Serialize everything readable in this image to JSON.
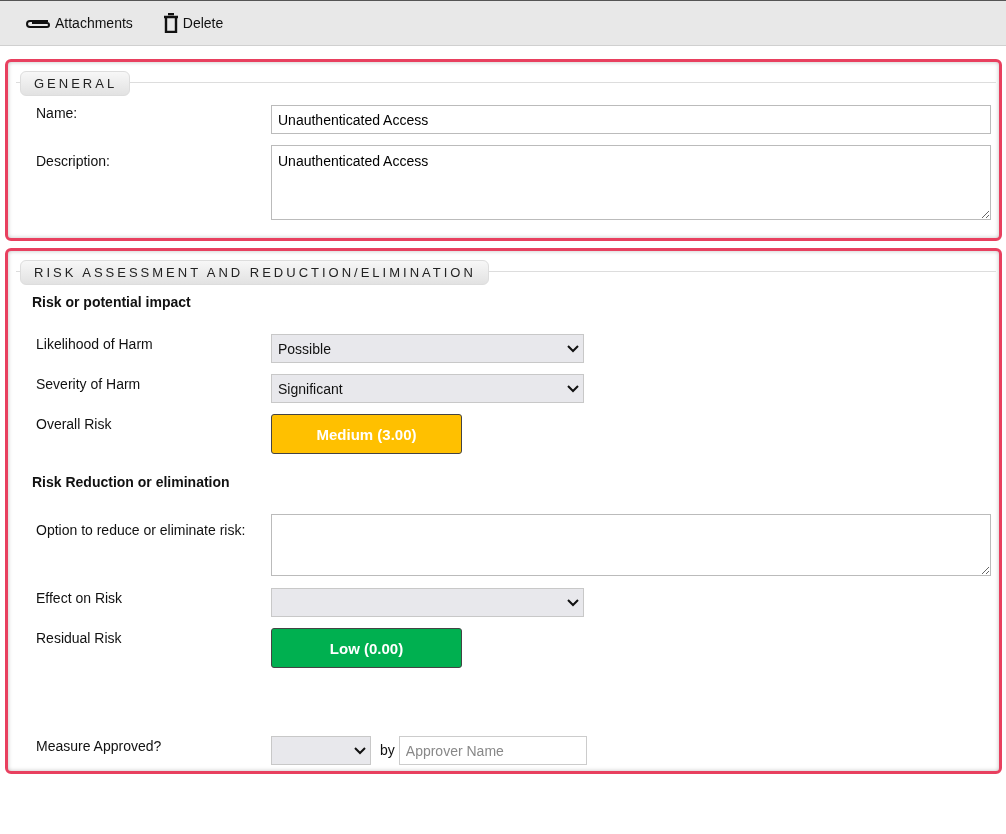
{
  "toolbar": [
    {
      "kind": "attach",
      "label": "Attachments"
    },
    {
      "kind": "delete",
      "label": "Delete"
    }
  ],
  "sections": [
    {
      "title": "GENERAL",
      "rows": [
        {
          "kind": "text",
          "label": "Name:",
          "value": "Unauthenticated Access"
        },
        {
          "kind": "textarea",
          "label": "Description:",
          "value": "Unauthenticated Access"
        }
      ]
    },
    {
      "title": "RISK ASSESSMENT AND REDUCTION/ELIMINATION",
      "rows": [
        {
          "kind": "heading",
          "label": "Risk or potential impact"
        },
        {
          "kind": "select",
          "label": "Likelihood of Harm",
          "value": "Possible"
        },
        {
          "kind": "select",
          "label": "Severity of Harm",
          "value": "Significant"
        },
        {
          "kind": "risk",
          "label": "Overall Risk",
          "value": "Medium (3.00)",
          "color": "#ffc000"
        },
        {
          "kind": "heading",
          "label": "Risk Reduction or elimination"
        },
        {
          "kind": "textarea",
          "label": "Option to reduce or eliminate risk:"
        },
        {
          "kind": "select",
          "label": "Effect on Risk"
        },
        {
          "kind": "risk",
          "label": "Residual Risk",
          "value": "Low (0.00)",
          "color": "#00b050"
        },
        {
          "kind": "approval",
          "label": "Measure Approved?",
          "by": "by",
          "placeholder": "Approver Name"
        }
      ]
    }
  ]
}
